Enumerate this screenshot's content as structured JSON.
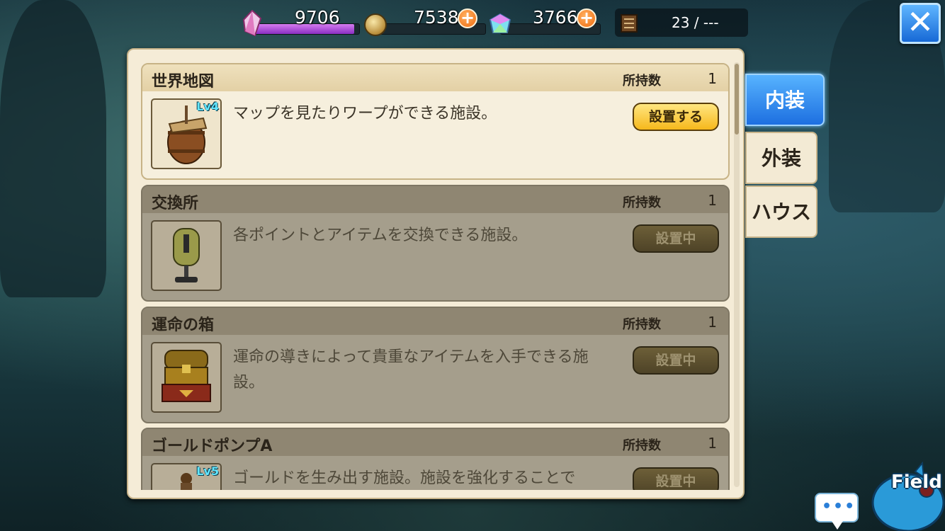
{
  "top_bar": {
    "crystal": {
      "value": "9706",
      "icon": "crystal-icon",
      "fill_fraction": 0.95
    },
    "gold": {
      "value": "7538",
      "icon": "coin-icon",
      "add_label": "+"
    },
    "gems": {
      "value": "3766",
      "icon": "gem-icon",
      "add_label": "+"
    },
    "book": {
      "icon": "book-icon",
      "count": "23 / ---"
    },
    "close_label": "✕"
  },
  "items": [
    {
      "title": "世界地図",
      "own_label": "所持数",
      "own_value": "1",
      "level": "Lv4",
      "description": "マップを見たりワープができる施設。",
      "button": "設置する",
      "state": "active",
      "thumb_icon": "barrel-map-icon"
    },
    {
      "title": "交換所",
      "own_label": "所持数",
      "own_value": "1",
      "level": "",
      "description": "各ポイントとアイテムを交換できる施設。",
      "button": "設置中",
      "state": "dim",
      "thumb_icon": "exchange-machine-icon"
    },
    {
      "title": "運命の箱",
      "own_label": "所持数",
      "own_value": "1",
      "level": "",
      "description": "運命の導きによって貴重なアイテムを入手できる施設。",
      "button": "設置中",
      "state": "dim",
      "thumb_icon": "treasure-chest-icon"
    },
    {
      "title": "ゴールドポンプA",
      "own_label": "所持数",
      "own_value": "1",
      "level": "Lv5",
      "description": "ゴールドを生み出す施設。施設を強化することで",
      "button": "設置中",
      "state": "dim",
      "thumb_icon": "gold-pump-icon"
    }
  ],
  "tabs": [
    {
      "label": "内装",
      "active": true
    },
    {
      "label": "外装",
      "active": false
    },
    {
      "label": "ハウス",
      "active": false
    }
  ],
  "bottom": {
    "chat_icon": "chat-bubble-icon",
    "chat_dots": "•••",
    "field_label": "Field"
  },
  "colors": {
    "active_tab": "#1d6fe0",
    "primary_button": "#f6b81c",
    "disabled_button": "#4e4327",
    "crystal_bar": "#b04fe0",
    "level_text": "#62e6ff"
  }
}
